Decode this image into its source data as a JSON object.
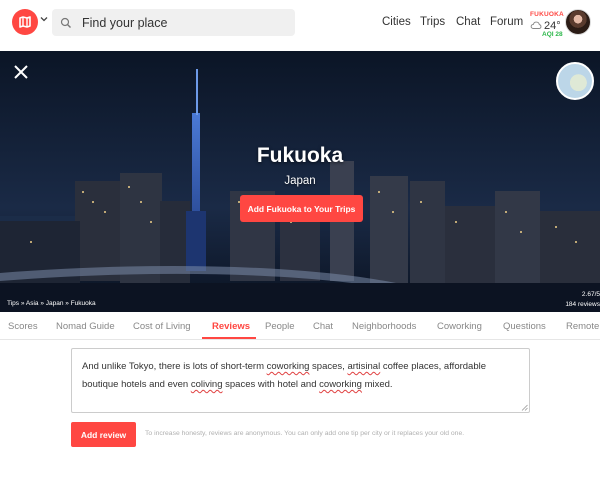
{
  "header": {
    "search_placeholder": "Find your place",
    "nav": [
      "Cities",
      "Trips",
      "Chat",
      "Forum"
    ],
    "weather": {
      "city": "FUKUOKA",
      "temp": "24°",
      "aqi": "AQI 28",
      "icon": "cloud-icon"
    }
  },
  "hero": {
    "city": "Fukuoka",
    "country": "Japan",
    "cta": "Add Fukuoka to Your Trips",
    "breadcrumb": "Tips » Asia » Japan » Fukuoka",
    "rating": "2.67/5",
    "reviews_count": "184 reviews"
  },
  "tabs": [
    "Scores",
    "Nomad Guide",
    "Cost of Living",
    "Reviews",
    "People",
    "Chat",
    "Neighborhoods",
    "Coworking",
    "Questions",
    "Remote"
  ],
  "active_tab": "Reviews",
  "review": {
    "text_parts": [
      "And unlike Tokyo, there is lots of short-term ",
      "coworking",
      " spaces, ",
      "artisinal",
      " coffee places, affordable boutique hotels and even ",
      "coliving",
      " spaces with hotel and ",
      "coworking",
      " mixed."
    ],
    "button": "Add review",
    "hint": "To increase honesty, reviews are anonymous. You can only add one tip per city or it replaces your old one."
  },
  "colors": {
    "accent": "#ff4742",
    "aqi_good": "#2db84b"
  }
}
